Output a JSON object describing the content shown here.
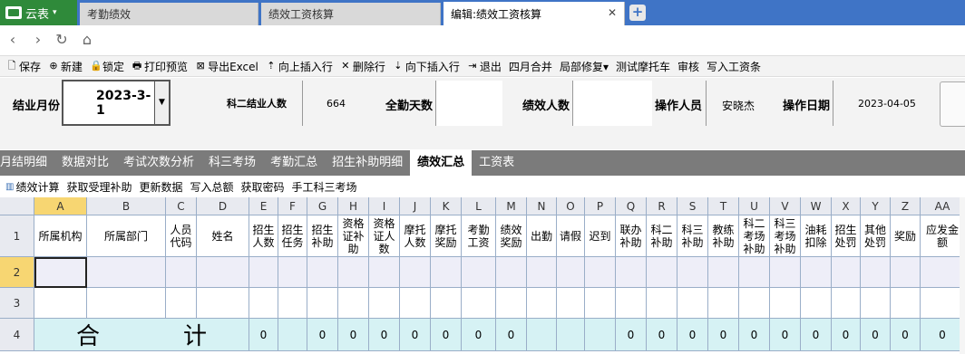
{
  "brand": {
    "label": "云表",
    "color": "#2f8a3a"
  },
  "tabs": [
    {
      "label": "考勤绩效"
    },
    {
      "label": "绩效工资核算"
    },
    {
      "label": "编辑:绩效工资核算",
      "active": true
    }
  ],
  "nav": {
    "back_icon": "chevron-left-icon",
    "forward_icon": "chevron-right-icon",
    "refresh_icon": "refresh-icon",
    "home_icon": "home-icon"
  },
  "toolbar": {
    "items": [
      {
        "label": "保存",
        "icon": "save-icon",
        "glyph": "🗋"
      },
      {
        "label": "新建",
        "icon": "new-icon",
        "glyph": "⊕"
      },
      {
        "label": "锁定",
        "icon": "lock-icon",
        "glyph": "🔒"
      },
      {
        "label": "打印预览",
        "icon": "print-icon",
        "glyph": "🖶"
      },
      {
        "label": "导出Excel",
        "icon": "excel-icon",
        "glyph": "⊠"
      },
      {
        "label": "向上插入行",
        "icon": "insert-row-up-icon",
        "glyph": "⇡"
      },
      {
        "label": "删除行",
        "icon": "delete-row-icon",
        "glyph": "✕"
      },
      {
        "label": "向下插入行",
        "icon": "insert-row-down-icon",
        "glyph": "⇣"
      },
      {
        "label": "退出",
        "icon": "exit-icon",
        "glyph": "⇥"
      },
      {
        "label": "四月合并",
        "icon": "",
        "glyph": ""
      },
      {
        "label": "局部修复▾",
        "icon": "",
        "glyph": ""
      },
      {
        "label": "测试摩托车",
        "icon": "",
        "glyph": ""
      },
      {
        "label": "审核",
        "icon": "",
        "glyph": ""
      },
      {
        "label": "写入工资条",
        "icon": "",
        "glyph": ""
      }
    ]
  },
  "form": {
    "month_label": "结业月份",
    "month_value": "2023-3-1",
    "k2_label": "科二结业人数",
    "k2_value": "664",
    "attend_label": "全勤天数",
    "attend_value": "",
    "perf_label": "绩效人数",
    "perf_value": "",
    "operator_label": "操作人员",
    "operator_value": "安晓杰",
    "date_label": "操作日期",
    "date_value": "2023-04-05"
  },
  "section_tabs": [
    {
      "label": "月结明细"
    },
    {
      "label": "数据对比"
    },
    {
      "label": "考试次数分析"
    },
    {
      "label": "科三考场"
    },
    {
      "label": "考勤汇总"
    },
    {
      "label": "招生补助明细"
    },
    {
      "label": "绩效汇总",
      "active": true
    },
    {
      "label": "工资表"
    }
  ],
  "sub_toolbar": [
    {
      "label": "绩效计算"
    },
    {
      "label": "获取受理补助"
    },
    {
      "label": "更新数据"
    },
    {
      "label": "写入总额"
    },
    {
      "label": "获取密码"
    },
    {
      "label": "手工科三考场"
    }
  ],
  "grid": {
    "columns": [
      "A",
      "B",
      "C",
      "D",
      "E",
      "F",
      "G",
      "H",
      "I",
      "J",
      "K",
      "L",
      "M",
      "N",
      "O",
      "P",
      "Q",
      "R",
      "S",
      "T",
      "U",
      "V",
      "W",
      "X",
      "Y",
      "Z",
      "AA"
    ],
    "headers": [
      "所属机构",
      "所属部门",
      "人员\n代码",
      "姓名",
      "招生\n人数",
      "招生\n任务",
      "招生\n补助",
      "资格\n证补\n助",
      "资格\n证人\n数",
      "摩托\n人数",
      "摩托\n奖励",
      "考勤\n工资",
      "绩效\n奖励",
      "出勤",
      "请假",
      "迟到",
      "联办\n补助",
      "科二\n补助",
      "科三\n补助",
      "教练\n补助",
      "科二\n考场\n补助",
      "科三\n考场\n补助",
      "油耗\n扣除",
      "招生\n处罚",
      "其他\n处罚",
      "奖励",
      "应发金额"
    ],
    "row_numbers": [
      "1",
      "2",
      "3",
      "4"
    ],
    "total_label_1": "合",
    "total_label_2": "计",
    "totals": [
      "",
      "",
      "",
      "",
      "0",
      "",
      "0",
      "0",
      "0",
      "0",
      "0",
      "0",
      "0",
      "",
      "",
      "",
      "0",
      "0",
      "0",
      "0",
      "0",
      "0",
      "0",
      "0",
      "0",
      "0",
      "0"
    ]
  }
}
